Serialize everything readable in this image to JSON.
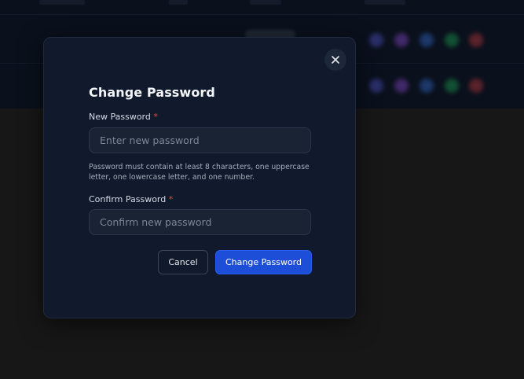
{
  "dialog": {
    "title": "Change Password",
    "close_icon": "close-icon",
    "new_password": {
      "label": "New Password",
      "required_mark": "*",
      "placeholder": "Enter new password",
      "value": ""
    },
    "hint": "Password must contain at least 8 characters, one uppercase letter, one lowercase letter, and one number.",
    "confirm_password": {
      "label": "Confirm Password",
      "required_mark": "*",
      "placeholder": "Confirm new password",
      "value": ""
    },
    "cancel_label": "Cancel",
    "submit_label": "Change Password"
  },
  "colors": {
    "accent": "#1d4ed8",
    "required": "#ef4444",
    "dialog_bg": "#101a2c",
    "overlay": "#171717"
  }
}
